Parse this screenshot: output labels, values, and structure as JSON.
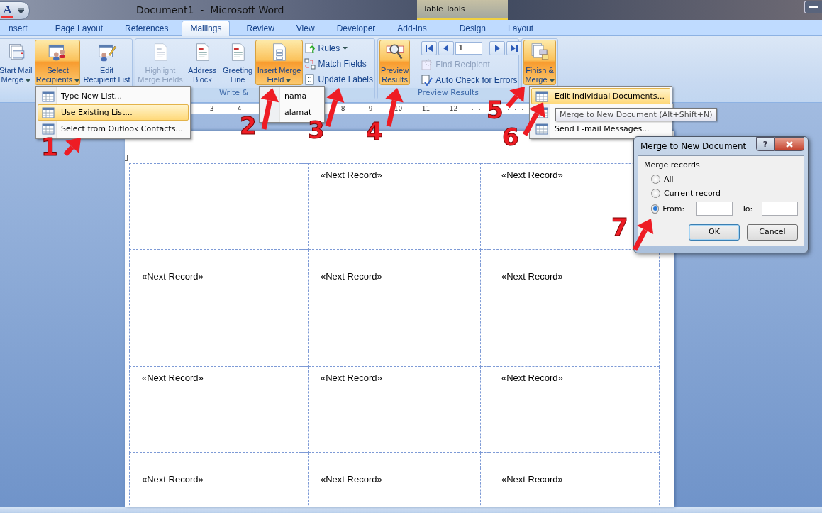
{
  "title_bar": {
    "quick_access_glyph": "A",
    "title": "Document1  -  Microsoft Word",
    "context_tab_group": "Table Tools"
  },
  "tabs": [
    {
      "label": "nsert",
      "selected": false
    },
    {
      "label": "Page Layout",
      "selected": false
    },
    {
      "label": "References",
      "selected": false
    },
    {
      "label": "Mailings",
      "selected": true
    },
    {
      "label": "Review",
      "selected": false
    },
    {
      "label": "View",
      "selected": false
    },
    {
      "label": "Developer",
      "selected": false
    },
    {
      "label": "Add-Ins",
      "selected": false
    },
    {
      "label": "Design",
      "selected": false
    },
    {
      "label": "Layout",
      "selected": false
    }
  ],
  "ribbon": {
    "groups": [
      {
        "items": [
          {
            "kind": "large",
            "label": "Start Mail\nMerge",
            "dropdown": true,
            "pressed": false,
            "disabled": false
          },
          {
            "kind": "large",
            "label": "Select\nRecipients",
            "dropdown": true,
            "pressed": true,
            "disabled": false
          },
          {
            "kind": "large",
            "label": "Edit\nRecipient List",
            "dropdown": false,
            "pressed": false,
            "disabled": false
          }
        ]
      },
      {
        "label": "Write &",
        "items": [
          {
            "kind": "large",
            "label": "Highlight\nMerge Fields",
            "dropdown": false,
            "pressed": false,
            "disabled": true
          },
          {
            "kind": "large",
            "label": "Address\nBlock",
            "dropdown": false,
            "pressed": false,
            "disabled": false
          },
          {
            "kind": "large",
            "label": "Greeting\nLine",
            "dropdown": false,
            "pressed": false,
            "disabled": false
          },
          {
            "kind": "large",
            "label": "Insert Merge\nField",
            "dropdown": true,
            "pressed": true,
            "disabled": false
          },
          {
            "kind": "small",
            "label": "Rules",
            "dropdown": true,
            "disabled": false
          },
          {
            "kind": "small",
            "label": "Match Fields",
            "dropdown": false,
            "disabled": false
          },
          {
            "kind": "small",
            "label": "Update Labels",
            "dropdown": false,
            "disabled": false
          }
        ]
      },
      {
        "label": "Preview Results",
        "items": [
          {
            "kind": "large",
            "label": "Preview\nResults",
            "dropdown": false,
            "pressed": true,
            "disabled": false
          },
          {
            "kind": "nav",
            "record": "1"
          },
          {
            "kind": "small",
            "label": "Find Recipient",
            "dropdown": false,
            "disabled": true
          },
          {
            "kind": "small",
            "label": "Auto Check for Errors",
            "dropdown": false,
            "disabled": false
          }
        ]
      },
      {
        "items": [
          {
            "kind": "large",
            "label": "Finish &\nMerge",
            "dropdown": true,
            "pressed": true,
            "disabled": false
          }
        ]
      }
    ]
  },
  "recipients_menu": {
    "items": [
      {
        "label": "Type New List...",
        "selected": false
      },
      {
        "label": "Use Existing List...",
        "selected": true
      },
      {
        "label": "Select from Outlook Contacts...",
        "selected": false
      }
    ]
  },
  "merge_field_menu": {
    "items": [
      {
        "label": "nama",
        "selected": false
      },
      {
        "label": "alamat",
        "selected": false
      }
    ]
  },
  "finish_merge_menu": {
    "items": [
      {
        "label": "Edit Individual Documents...",
        "selected": true
      },
      {
        "selected": false
      },
      {
        "label": "Send E-mail Messages...",
        "selected": false
      }
    ]
  },
  "tooltip": "Merge to New Document (Alt+Shift+N)",
  "ruler": {
    "left_numbers": [
      "3",
      "4"
    ],
    "right_numbers": [
      "8",
      "9",
      "10",
      "11",
      "12"
    ]
  },
  "document": {
    "rows": [
      {
        "cells": [
          {
            "kind": "empty"
          },
          {
            "kind": "field",
            "text": "«Next Record»"
          },
          {
            "kind": "field",
            "text": "«Next Record»"
          }
        ]
      },
      {
        "cells": [
          {
            "kind": "field",
            "text": "«Next Record»"
          },
          {
            "kind": "field",
            "text": "«Next Record»"
          },
          {
            "kind": "field",
            "text": "«Next Record»"
          }
        ]
      },
      {
        "cells": [
          {
            "kind": "field",
            "text": "«Next Record»"
          },
          {
            "kind": "field",
            "text": "«Next Record»"
          },
          {
            "kind": "field",
            "text": "«Next Record»"
          }
        ]
      },
      {
        "cells": [
          {
            "kind": "field",
            "text": "«Next Record»"
          },
          {
            "kind": "field",
            "text": "«Next Record»"
          },
          {
            "kind": "field",
            "text": "«Next Record»"
          }
        ]
      }
    ]
  },
  "dialog": {
    "title": "Merge to New Document",
    "help_glyph": "?",
    "group_label": "Merge records",
    "options": [
      {
        "label": "All",
        "selected": false
      },
      {
        "label": "Current record",
        "selected": false
      },
      {
        "label": "From:",
        "selected": true
      }
    ],
    "to_label": "To:",
    "buttons": [
      "OK",
      "Cancel"
    ]
  },
  "annotations": [
    "1",
    "2",
    "3",
    "4",
    "5",
    "6",
    "7"
  ]
}
